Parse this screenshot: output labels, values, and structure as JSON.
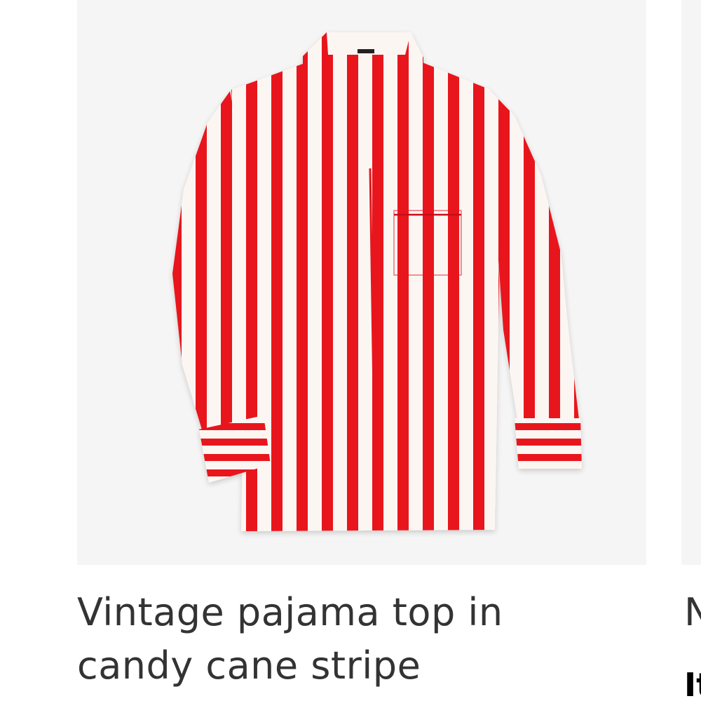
{
  "product": {
    "title_line1": "Vintage pajama top in",
    "title_line2": "candy cane stripe",
    "image": {
      "icon": "striped-shirt-image",
      "stripe_color": "#e8131f",
      "background_color": "#f5f5f5"
    }
  },
  "next_product": {
    "title_partial": "N",
    "badge_partial": "It"
  },
  "colors": {
    "text": "#333333",
    "image_bg": "#f5f5f5"
  }
}
